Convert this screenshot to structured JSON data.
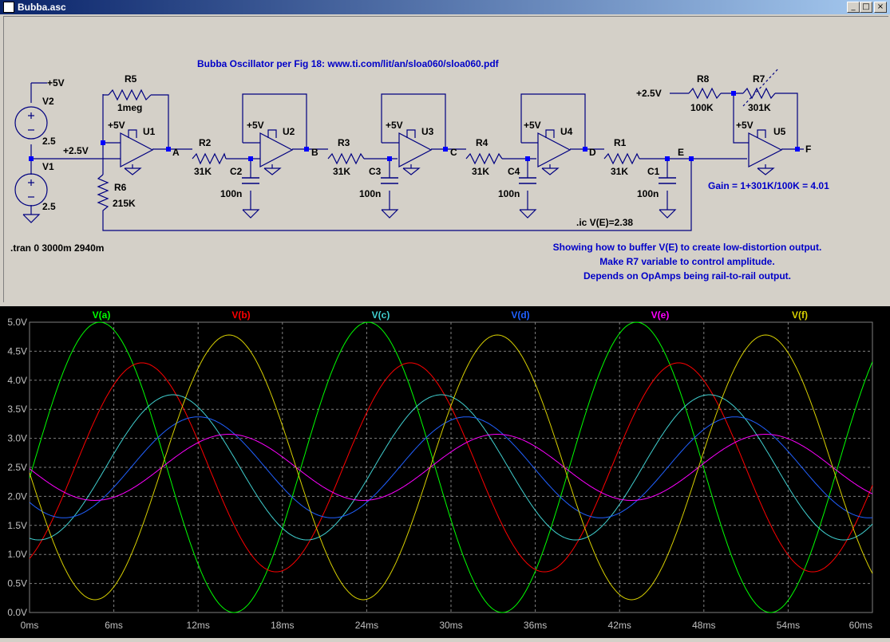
{
  "window": {
    "title": "Bubba.asc"
  },
  "schematic": {
    "title_text": "Bubba Oscillator per Fig 18: www.ti.com/lit/an/sloa060/sloa060.pdf",
    "supply_label": "+5V",
    "v2": {
      "name": "V2",
      "value": "2.5"
    },
    "v1": {
      "name": "V1",
      "value": "2.5"
    },
    "v1_node": "+2.5V",
    "r5": {
      "name": "R5",
      "value": "1meg"
    },
    "r6": {
      "name": "R6",
      "value": "215K"
    },
    "r2": {
      "name": "R2",
      "value": "31K"
    },
    "r3": {
      "name": "R3",
      "value": "31K"
    },
    "r4": {
      "name": "R4",
      "value": "31K"
    },
    "r1": {
      "name": "R1",
      "value": "31K"
    },
    "r8": {
      "name": "R8",
      "value": "100K"
    },
    "r7": {
      "name": "R7",
      "value": "301K"
    },
    "r8_node": "+2.5V",
    "c2": {
      "name": "C2",
      "value": "100n"
    },
    "c3": {
      "name": "C3",
      "value": "100n"
    },
    "c4": {
      "name": "C4",
      "value": "100n"
    },
    "c1": {
      "name": "C1",
      "value": "100n"
    },
    "u1": "U1",
    "u2": "U2",
    "u3": "U3",
    "u4": "U4",
    "u5": "U5",
    "nodes": {
      "a": "A",
      "b": "B",
      "c": "C",
      "d": "D",
      "e": "E",
      "f": "F"
    },
    "ic_directive": ".ic V(E)=2.38",
    "tran_directive": ".tran 0 3000m 2940m",
    "gain_text": "Gain = 1+301K/100K = 4.01",
    "notes": [
      "Showing how to buffer V(E) to create low-distortion output.",
      "Make R7 variable to control amplitude.",
      "Depends on OpAmps being rail-to-rail output."
    ],
    "label_color": "#0000c8",
    "wire_color": "#000080"
  },
  "plot": {
    "legend": [
      {
        "name": "V(a)",
        "color": "#00ff00"
      },
      {
        "name": "V(b)",
        "color": "#ff0000"
      },
      {
        "name": "V(c)",
        "color": "#40d0d0"
      },
      {
        "name": "V(d)",
        "color": "#2060ff"
      },
      {
        "name": "V(e)",
        "color": "#ff00ff"
      },
      {
        "name": "V(f)",
        "color": "#d8d000"
      }
    ],
    "y_ticks": [
      "0.0V",
      "0.5V",
      "1.0V",
      "1.5V",
      "2.0V",
      "2.5V",
      "3.0V",
      "3.5V",
      "4.0V",
      "4.5V",
      "5.0V"
    ],
    "x_ticks": [
      "0ms",
      "6ms",
      "12ms",
      "18ms",
      "24ms",
      "30ms",
      "36ms",
      "42ms",
      "48ms",
      "54ms",
      "60ms"
    ]
  },
  "chart_data": {
    "type": "line",
    "x_unit": "ms",
    "y_unit": "V",
    "xlim": [
      0,
      60
    ],
    "ylim": [
      0,
      5
    ],
    "grid": true,
    "legend_placement": "top",
    "period_ms": 19.1,
    "series": [
      {
        "name": "V(a)",
        "color": "#00ff00",
        "offset_v": 2.5,
        "amplitude_v": 2.5,
        "first_peak_ms": 5.0,
        "clipped": true
      },
      {
        "name": "V(b)",
        "color": "#ff0000",
        "offset_v": 2.5,
        "amplitude_v": 1.8,
        "first_peak_ms": 8.0
      },
      {
        "name": "V(c)",
        "color": "#40d0d0",
        "offset_v": 2.5,
        "amplitude_v": 1.25,
        "first_peak_ms": 10.2
      },
      {
        "name": "V(d)",
        "color": "#2060ff",
        "offset_v": 2.5,
        "amplitude_v": 0.87,
        "first_peak_ms": 12.0
      },
      {
        "name": "V(e)",
        "color": "#ff00ff",
        "offset_v": 2.5,
        "amplitude_v": 0.57,
        "first_peak_ms": 14.2
      },
      {
        "name": "V(f)",
        "color": "#d8d000",
        "offset_v": 2.5,
        "amplitude_v": 2.28,
        "first_peak_ms": 14.2
      }
    ]
  }
}
